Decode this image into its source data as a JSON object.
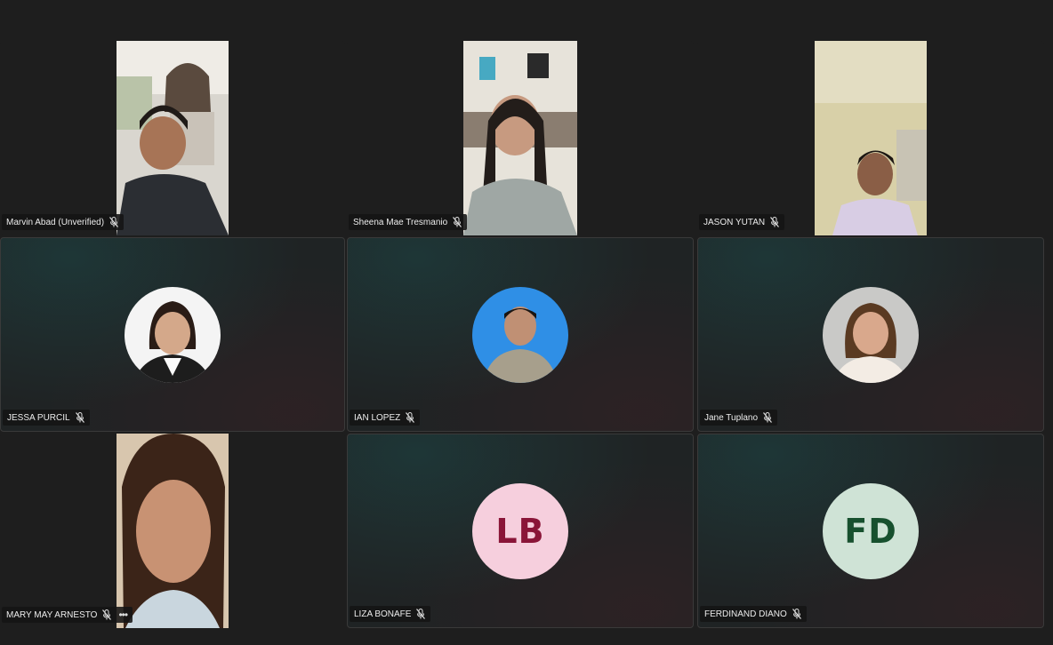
{
  "participants": [
    {
      "name": "Marvin Abad (Unverified)"
    },
    {
      "name": "Sheena Mae Tresmanio"
    },
    {
      "name": "JASON YUTAN"
    },
    {
      "name": "JESSA PURCIL"
    },
    {
      "name": "IAN LOPEZ"
    },
    {
      "name": "Jane Tuplano"
    },
    {
      "name": "MARY MAY ARNESTO"
    },
    {
      "name": "LIZA BONAFE",
      "initials": "LB",
      "avatar_bg": "#f6cfdd",
      "avatar_fg": "#8a1538"
    },
    {
      "name": "FERDINAND DIANO",
      "initials": "FD",
      "avatar_bg": "#cfe3d6",
      "avatar_fg": "#17502e"
    }
  ],
  "icons": {
    "mic_muted": "mic-muted-icon",
    "more": "more-options-icon",
    "more_glyph": "•••"
  }
}
